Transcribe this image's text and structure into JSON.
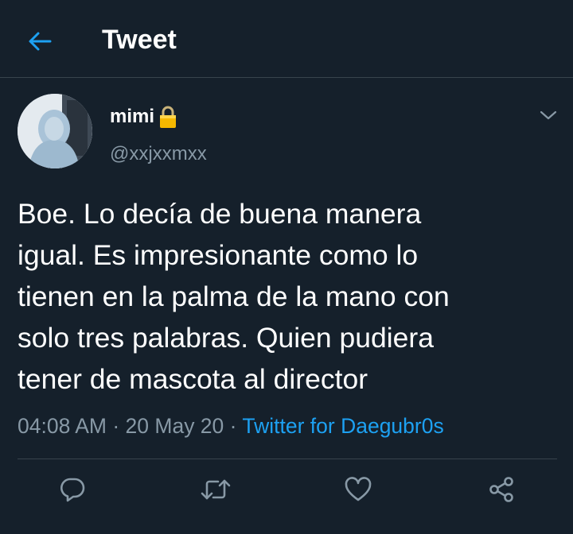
{
  "header": {
    "title": "Tweet",
    "back_icon": "arrow-left-icon",
    "accent": "#1da1f2"
  },
  "author": {
    "display_name": "mimi",
    "handle": "@xxjxxmxx",
    "badge_icon": "lock-icon"
  },
  "tweet": {
    "text": "Boe. Lo decía de buena manera\nigual. Es impresionante como lo\ntienen en la palma de la mano con\nsolo tres palabras. Quien pudiera\ntener de mascota al director",
    "time": "04:08 AM",
    "separator": "·",
    "date": "20 May 20",
    "source": "Twitter for Daegubr0s"
  },
  "actions": {
    "icons": [
      "reply-icon",
      "retweet-icon",
      "like-icon",
      "share-icon"
    ]
  },
  "colors": {
    "background": "#15202b",
    "secondary_text": "#8899a6",
    "divider": "#38444d"
  }
}
